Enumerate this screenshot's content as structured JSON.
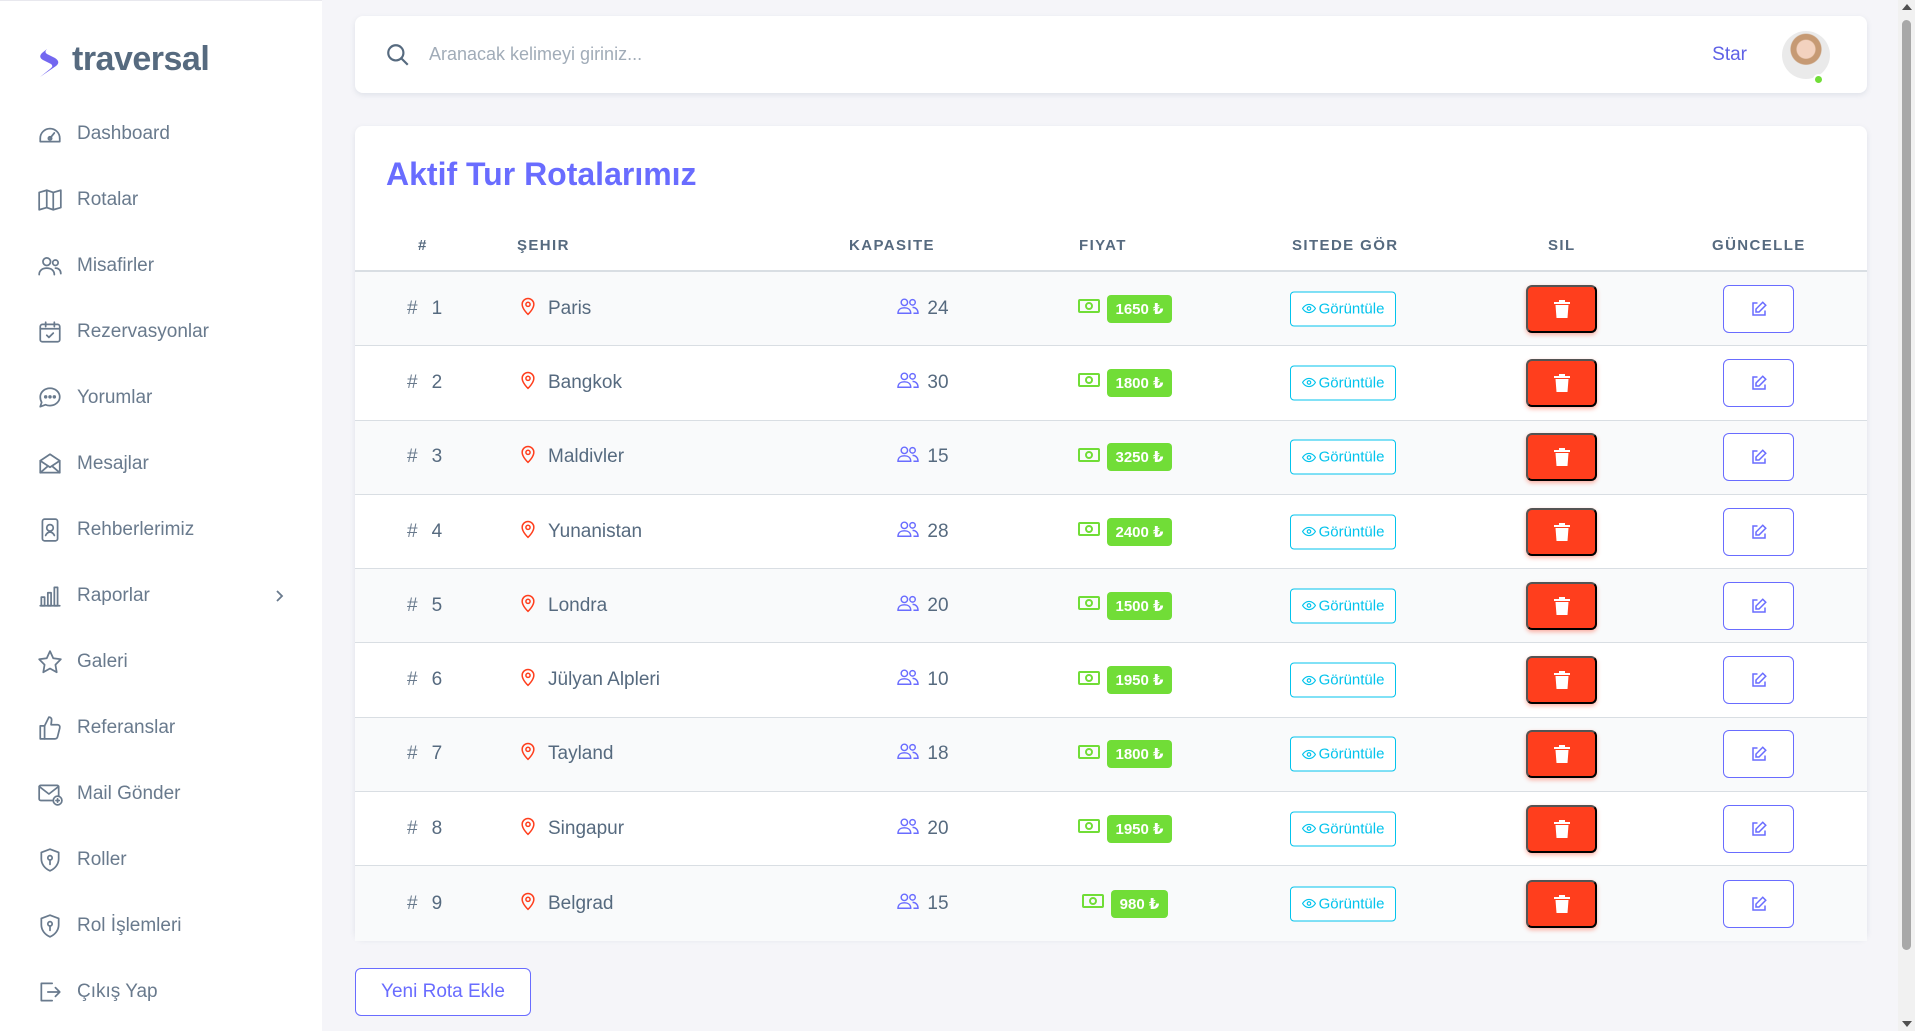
{
  "brand": {
    "name": "traversal"
  },
  "sidebar": {
    "items": [
      {
        "label": "Dashboard",
        "icon": "dashboard-icon"
      },
      {
        "label": "Rotalar",
        "icon": "map-icon"
      },
      {
        "label": "Misafirler",
        "icon": "users-icon"
      },
      {
        "label": "Rezervasyonlar",
        "icon": "calendar-check-icon"
      },
      {
        "label": "Yorumlar",
        "icon": "comment-icon"
      },
      {
        "label": "Mesajlar",
        "icon": "envelope-icon"
      },
      {
        "label": "Rehberlerimiz",
        "icon": "id-badge-icon"
      },
      {
        "label": "Raporlar",
        "icon": "bar-chart-icon"
      },
      {
        "label": "Galeri",
        "icon": "star-icon"
      },
      {
        "label": "Referanslar",
        "icon": "like-icon"
      },
      {
        "label": "Mail Gönder",
        "icon": "mail-send-icon"
      },
      {
        "label": "Roller",
        "icon": "shield-icon"
      },
      {
        "label": "Rol İşlemleri",
        "icon": "shield-lock-icon"
      },
      {
        "label": "Çıkış Yap",
        "icon": "logout-icon"
      }
    ]
  },
  "topbar": {
    "search_placeholder": "Aranacak kelimeyi giriniz...",
    "star_label": "Star"
  },
  "main": {
    "title": "Aktif Tur Rotalarımız",
    "columns": [
      "#",
      "ŞEHIR",
      "KAPASITE",
      "FIYAT",
      "SITEDE GÖR",
      "SIL",
      "GÜNCELLE"
    ],
    "view_label": "Görüntüle",
    "add_button_label": "Yeni Rota Ekle",
    "rows": [
      {
        "num": "1",
        "city": "Paris",
        "capacity": "24",
        "price": "1650 ₺"
      },
      {
        "num": "2",
        "city": "Bangkok",
        "capacity": "30",
        "price": "1800 ₺"
      },
      {
        "num": "3",
        "city": "Maldivler",
        "capacity": "15",
        "price": "3250 ₺"
      },
      {
        "num": "4",
        "city": "Yunanistan",
        "capacity": "28",
        "price": "2400 ₺"
      },
      {
        "num": "5",
        "city": "Londra",
        "capacity": "20",
        "price": "1500 ₺"
      },
      {
        "num": "6",
        "city": "Jülyan Alpleri",
        "capacity": "10",
        "price": "1950 ₺"
      },
      {
        "num": "7",
        "city": "Tayland",
        "capacity": "18",
        "price": "1800 ₺"
      },
      {
        "num": "8",
        "city": "Singapur",
        "capacity": "20",
        "price": "1950 ₺"
      },
      {
        "num": "9",
        "city": "Belgrad",
        "capacity": "15",
        "price": "980 ₺"
      }
    ]
  },
  "colors": {
    "primary": "#696cff",
    "danger": "#ff3e1d",
    "success": "#71dd37",
    "info": "#03c3ec"
  }
}
